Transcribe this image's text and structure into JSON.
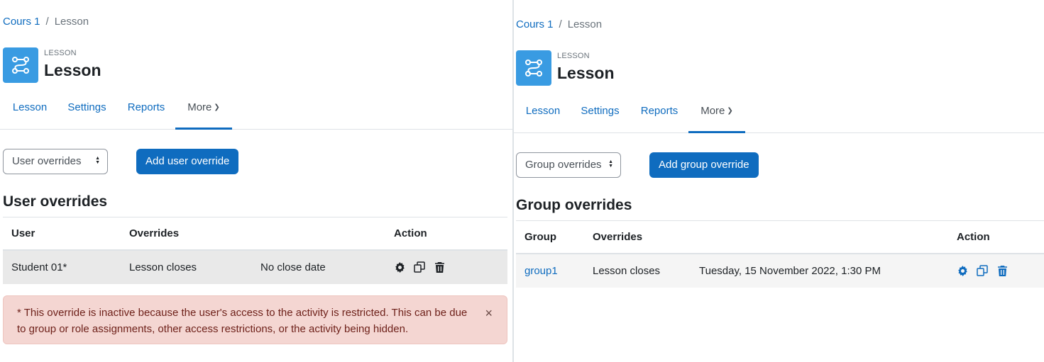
{
  "left": {
    "breadcrumb": {
      "course": "Cours 1",
      "separator": "/",
      "current": "Lesson"
    },
    "header": {
      "kind": "LESSON",
      "title": "Lesson"
    },
    "tabs": [
      {
        "label": "Lesson"
      },
      {
        "label": "Settings"
      },
      {
        "label": "Reports"
      },
      {
        "label": "More"
      }
    ],
    "select": {
      "value": "User overrides"
    },
    "add_button": "Add user override",
    "section_title": "User overrides",
    "table": {
      "headers": [
        "User",
        "Overrides",
        "Action"
      ],
      "rows": [
        {
          "name": "Student 01*",
          "setting": "Lesson closes",
          "value": "No close date"
        }
      ]
    },
    "alert": {
      "text": "* This override is inactive because the user's access to the activity is restricted. This can be due to group or role assignments, other access restrictions, or the activity being hidden.",
      "close": "×"
    }
  },
  "right": {
    "breadcrumb": {
      "course": "Cours 1",
      "separator": "/",
      "current": "Lesson"
    },
    "header": {
      "kind": "LESSON",
      "title": "Lesson"
    },
    "tabs": [
      {
        "label": "Lesson"
      },
      {
        "label": "Settings"
      },
      {
        "label": "Reports"
      },
      {
        "label": "More"
      }
    ],
    "select": {
      "value": "Group overrides"
    },
    "add_button": "Add group override",
    "section_title": "Group overrides",
    "table": {
      "headers": [
        "Group",
        "Overrides",
        "Action"
      ],
      "rows": [
        {
          "name": "group1",
          "setting": "Lesson closes",
          "value": "Tuesday, 15 November 2022, 1:30 PM"
        }
      ]
    }
  },
  "icons": {
    "module": "lesson-flow-icon",
    "edit": "gear-icon",
    "copy": "copy-icon",
    "delete": "trash-icon",
    "dropdown": "chevron-down-icon",
    "select": "updown-arrows-icon",
    "close": "close-icon"
  },
  "colors": {
    "link": "#0f6cbf",
    "primary_button": "#0f6cbf",
    "module_icon_bg": "#399be2",
    "alert_bg": "#f4d6d2",
    "alert_text": "#6e211a",
    "row_highlight": "#e9e9e9",
    "row_default": "#f5f5f5"
  }
}
